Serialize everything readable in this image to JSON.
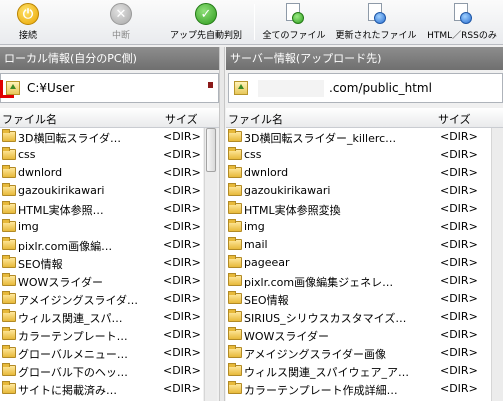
{
  "toolbar": {
    "connect_label": "接続",
    "stop_label": "中断",
    "auto_detect_label": "アップ先自動判別",
    "all_files_label": "全てのファイル",
    "updated_files_label": "更新されたファイル",
    "html_rss_label": "HTML／RSSのみ"
  },
  "local_panel": {
    "title": "ローカル情報(自分のPC側)",
    "path": "C:¥User",
    "col_name": "ファイル名",
    "col_size": "サイズ",
    "rows": [
      {
        "name": "3D横回転スライダ…",
        "size": "<DIR>"
      },
      {
        "name": "css",
        "size": "<DIR>"
      },
      {
        "name": "dwnlord",
        "size": "<DIR>"
      },
      {
        "name": "gazoukirikawari",
        "size": "<DIR>"
      },
      {
        "name": "HTML実体参照…",
        "size": "<DIR>"
      },
      {
        "name": "img",
        "size": "<DIR>"
      },
      {
        "name": "pixlr.com画像編…",
        "size": "<DIR>"
      },
      {
        "name": "SEO情報",
        "size": "<DIR>"
      },
      {
        "name": "WOWスライダー",
        "size": "<DIR>"
      },
      {
        "name": "アメイジングスライダ…",
        "size": "<DIR>"
      },
      {
        "name": "ウィルス関連_スパ…",
        "size": "<DIR>"
      },
      {
        "name": "カラーテンプレート…",
        "size": "<DIR>"
      },
      {
        "name": "グローバルメニュー…",
        "size": "<DIR>"
      },
      {
        "name": "グローバル下のヘッ…",
        "size": "<DIR>"
      },
      {
        "name": "サイトに掲載済み…",
        "size": "<DIR>"
      }
    ]
  },
  "server_panel": {
    "title": "サーバー情報(アップロード先)",
    "path": ".com/public_html",
    "col_name": "ファイル名",
    "col_size": "サイズ",
    "rows": [
      {
        "name": "3D横回転スライダー_killerc…",
        "size": "<DIR>"
      },
      {
        "name": "css",
        "size": "<DIR>"
      },
      {
        "name": "dwnlord",
        "size": "<DIR>"
      },
      {
        "name": "gazoukirikawari",
        "size": "<DIR>"
      },
      {
        "name": "HTML実体参照変換",
        "size": "<DIR>"
      },
      {
        "name": "img",
        "size": "<DIR>"
      },
      {
        "name": "mail",
        "size": "<DIR>"
      },
      {
        "name": "pageear",
        "size": "<DIR>"
      },
      {
        "name": "pixlr.com画像編集ジェネレ…",
        "size": "<DIR>"
      },
      {
        "name": "SEO情報",
        "size": "<DIR>"
      },
      {
        "name": "SIRIUS_シリウスカスタマイズ…",
        "size": "<DIR>"
      },
      {
        "name": "WOWスライダー",
        "size": "<DIR>"
      },
      {
        "name": "アメイジングスライダー画像",
        "size": "<DIR>"
      },
      {
        "name": "ウィルス関連_スパイウェア_ア…",
        "size": "<DIR>"
      },
      {
        "name": "カラーテンプレート作成詳細…",
        "size": "<DIR>"
      }
    ]
  }
}
